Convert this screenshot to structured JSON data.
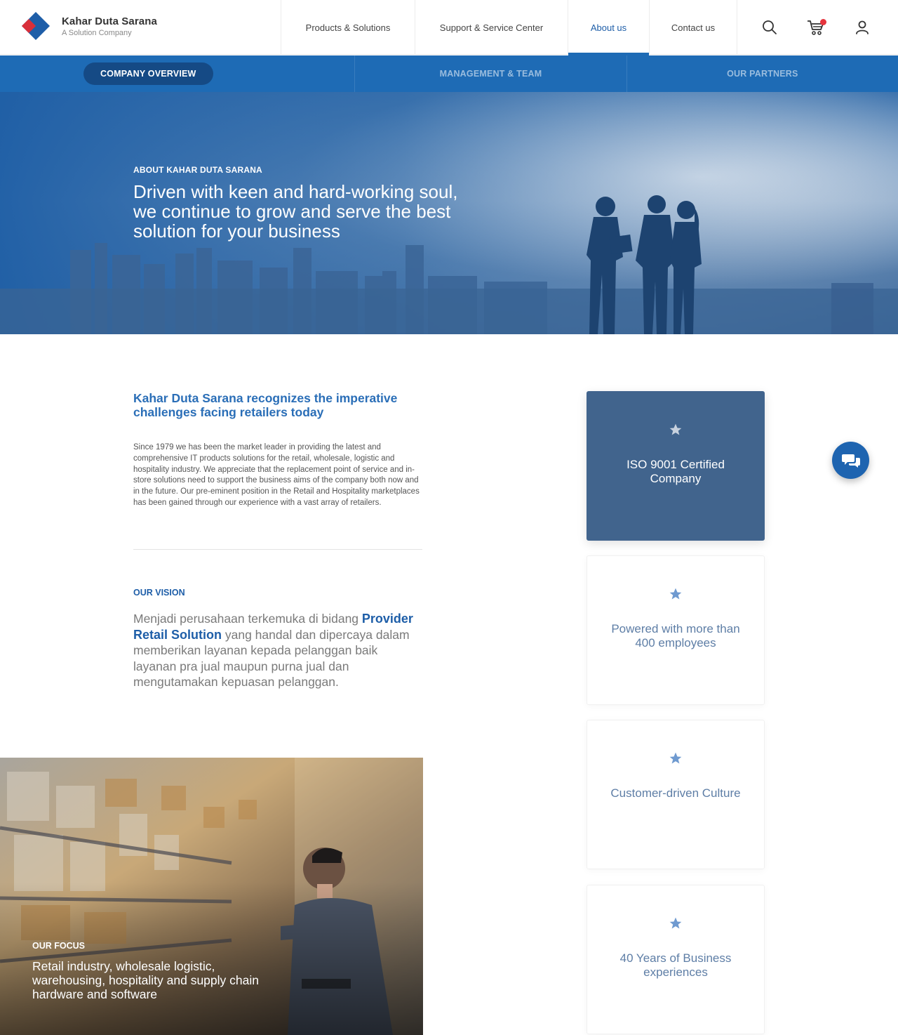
{
  "brand": {
    "name": "Kahar Duta Sarana",
    "tagline": "A Solution Company"
  },
  "nav": {
    "items": [
      {
        "label": "Products & Solutions"
      },
      {
        "label": "Support & Service Center"
      },
      {
        "label": "About us"
      },
      {
        "label": "Contact us"
      }
    ],
    "active": "About us",
    "icons": [
      "search-icon",
      "cart-icon",
      "user-icon"
    ]
  },
  "subnav": {
    "items": [
      {
        "label": "COMPANY OVERVIEW"
      },
      {
        "label": "MANAGEMENT & TEAM"
      },
      {
        "label": "OUR PARTNERS"
      }
    ],
    "active": "COMPANY OVERVIEW"
  },
  "hero": {
    "eyebrow": "ABOUT KAHAR DUTA SARANA",
    "title": "Driven with keen and hard-working soul, we continue to grow and serve the best solution for your business"
  },
  "intro": {
    "title": "Kahar Duta Sarana recognizes the imperative challenges facing retailers today",
    "body": "Since 1979 we has been the market leader in providing the latest and comprehensive IT products solutions for the retail, wholesale, logistic and hospitality industry. We appreciate that the replacement point of service and in-store solutions need to support the business aims of the company both now and in the future. Our pre-eminent position in the Retail and Hospitality marketplaces has been gained through our experience with a vast array of retailers."
  },
  "vision": {
    "label": "OUR VISION",
    "text_before": "Menjadi perusahaan terkemuka di bidang ",
    "highlight": "Provider Retail Solution",
    "text_after": " yang handal dan dipercaya dalam memberikan layanan kepada pelanggan baik layanan pra jual maupun purna jual dan mengutamakan kepuasan pelanggan."
  },
  "focus": {
    "label": "OUR FOCUS",
    "text": "Retail industry, wholesale logistic, warehousing, hospitality and supply chain hardware and software"
  },
  "features": [
    {
      "label": "ISO 9001 Certified Company"
    },
    {
      "label": "Powered with more than 400 employees"
    },
    {
      "label": "Customer-driven Culture"
    },
    {
      "label": "40 Years of Business experiences"
    }
  ],
  "colors": {
    "primary": "#1e6bb5",
    "dark": "#154a85",
    "card": "#41648d",
    "alert": "#e5343d"
  }
}
